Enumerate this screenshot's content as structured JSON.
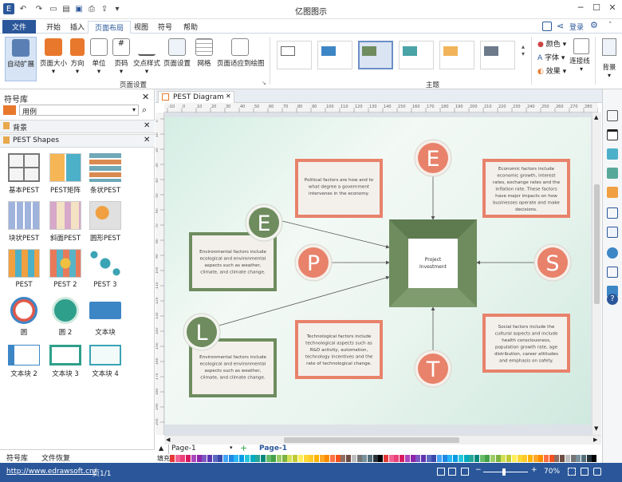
{
  "app": {
    "title": "亿图图示"
  },
  "quick_access": [
    "app-logo-icon",
    "undo-icon",
    "redo-icon",
    "new-icon",
    "open-icon",
    "save-icon",
    "print-icon",
    "export-icon",
    "more-icon"
  ],
  "menu_tabs": [
    {
      "label": "文件"
    },
    {
      "label": "开始"
    },
    {
      "label": "插入"
    },
    {
      "label": "页面布局"
    },
    {
      "label": "视图"
    },
    {
      "label": "符号"
    },
    {
      "label": "帮助"
    }
  ],
  "active_tab": "页面布局",
  "header_right": {
    "login": "登录"
  },
  "ribbon": {
    "page_setup_buttons": [
      {
        "label": "自动扩展"
      },
      {
        "label": "页面大小"
      },
      {
        "label": "方向"
      },
      {
        "label": "单位"
      },
      {
        "label": "页码"
      },
      {
        "label": "交点样式"
      },
      {
        "label": "页面设置"
      },
      {
        "label": "网格"
      },
      {
        "label": "页面适应到绘图"
      }
    ],
    "page_setup_group": "页面设置",
    "theme_group": "主题",
    "theme_options": [
      {
        "label": "颜色",
        "icon": "palette-icon"
      },
      {
        "label": "字体",
        "icon": "font-icon"
      },
      {
        "label": "效果",
        "icon": "effects-icon"
      }
    ],
    "connector_label": "连接线",
    "background_label": "背景"
  },
  "left_panel": {
    "title": "符号库",
    "search_placeholder": "用例",
    "sections": [
      {
        "label": "背景"
      },
      {
        "label": "PEST Shapes"
      }
    ],
    "shapes": [
      {
        "label": "基本PEST"
      },
      {
        "label": "PEST矩阵"
      },
      {
        "label": "条状PEST"
      },
      {
        "label": "块状PEST"
      },
      {
        "label": "斜面PEST"
      },
      {
        "label": "圆形PEST"
      },
      {
        "label": "PEST"
      },
      {
        "label": "PEST 2"
      },
      {
        "label": "PEST 3"
      },
      {
        "label": "圆"
      },
      {
        "label": "圆 2"
      },
      {
        "label": "文本块"
      },
      {
        "label": "文本块 2"
      },
      {
        "label": "文本块 3"
      },
      {
        "label": "文本块 4"
      }
    ],
    "bottom_tabs": [
      {
        "label": "符号库"
      },
      {
        "label": "文件恢复"
      }
    ]
  },
  "document": {
    "tab_label": "PEST Diagram",
    "ruler_top": [
      "-10",
      "0",
      "10",
      "20",
      "30",
      "40",
      "50",
      "60",
      "70",
      "80",
      "90",
      "100",
      "110",
      "120",
      "130",
      "140",
      "150",
      "160",
      "170",
      "180",
      "190",
      "200",
      "210",
      "220",
      "230",
      "240",
      "250",
      "260",
      "270",
      "280",
      "290"
    ],
    "ruler_left": [
      "0",
      "10",
      "20",
      "30",
      "40",
      "50",
      "60",
      "70",
      "80",
      "90",
      "100",
      "110",
      "120",
      "130",
      "140",
      "150",
      "160",
      "170",
      "180",
      "190",
      "200"
    ]
  },
  "diagram": {
    "center_label_line1": "Project",
    "center_label_line2": "Investment",
    "circles": {
      "E_top": "E",
      "E_left": "E",
      "P": "P",
      "S": "S",
      "T": "T",
      "L": "L"
    },
    "boxes": {
      "political": [
        "Political factors are how and to",
        "what degree a government",
        "intervenes in the economy."
      ],
      "economic": [
        "Economic factors include",
        "economic growth, interest",
        "rates, exchange rates and the",
        "inflation rate. These factors",
        "have major impacts on how",
        "businesses operate and make",
        "decisions."
      ],
      "env1": [
        "Environmental factors include",
        "ecological and environmental",
        "aspects such as weather,",
        "climate, and climate change."
      ],
      "env2": [
        "Environmental factors include",
        "ecological and environmental",
        "aspects such as weather,",
        "climate, and climate change."
      ],
      "tech": [
        "Technological factors include",
        "technological aspects such as",
        "R&D activity, automation,",
        "technology incentives and the",
        "rate of technological change."
      ],
      "social": [
        "Social factors include the",
        "cultural aspects and include",
        "health consciousness,",
        "population growth rate, age",
        "distribution, career attitudes",
        "and emphasis on safety."
      ]
    }
  },
  "page_bar": {
    "page_select": "Page-1",
    "page_tab": "Page-1"
  },
  "palette_label": "填充",
  "status": {
    "url": "http://www.edrawsoft.cn/",
    "page": "页1/1",
    "zoom": "70%"
  },
  "colors": {
    "accent": "#2b579a",
    "green": "#6e8c5e",
    "orange": "#e8826b",
    "canvas": "#dde2e8"
  }
}
